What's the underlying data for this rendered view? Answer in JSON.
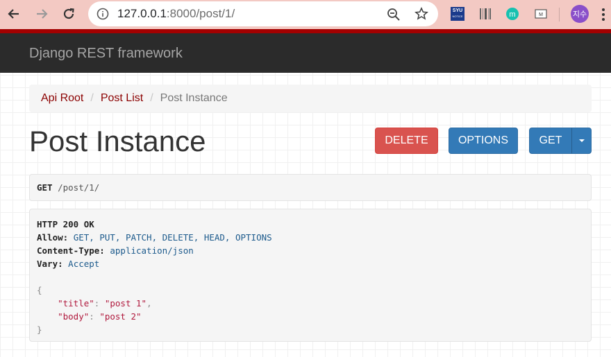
{
  "browser": {
    "url_host": "127.0.0.1",
    "url_rest": ":8000/post/1/",
    "profile_label": "지수",
    "extensions": [
      "syu-notice-icon",
      "barcode-icon",
      "m-icon",
      "mail-icon"
    ],
    "ext_syu_top": "SYU",
    "ext_syu_bottom": "NOTICE"
  },
  "navbar": {
    "brand": "Django REST framework"
  },
  "breadcrumb": {
    "items": [
      {
        "label": "Api Root"
      },
      {
        "label": "Post List"
      }
    ],
    "active": "Post Instance",
    "separator": "/"
  },
  "page": {
    "title": "Post Instance"
  },
  "buttons": {
    "delete": "DELETE",
    "options": "OPTIONS",
    "get": "GET"
  },
  "request": {
    "method": "GET",
    "path": "/post/1/"
  },
  "response": {
    "status": "HTTP 200 OK",
    "headers": [
      {
        "name": "Allow:",
        "value": "GET, PUT, PATCH, DELETE, HEAD, OPTIONS"
      },
      {
        "name": "Content-Type:",
        "value": "application/json"
      },
      {
        "name": "Vary:",
        "value": "Accept"
      }
    ],
    "body": {
      "open": "{",
      "close": "}",
      "fields": [
        {
          "key": "\"title\"",
          "value": "\"post 1\"",
          "trail": ","
        },
        {
          "key": "\"body\"",
          "value": "\"post 2\"",
          "trail": ""
        }
      ]
    }
  },
  "colors": {
    "chrome_bg": "#f3c9c3",
    "navbar_bg": "#2b2b2b",
    "accent_red": "#a30000",
    "delete_btn": "#d9534f",
    "primary_btn": "#337ab7"
  }
}
